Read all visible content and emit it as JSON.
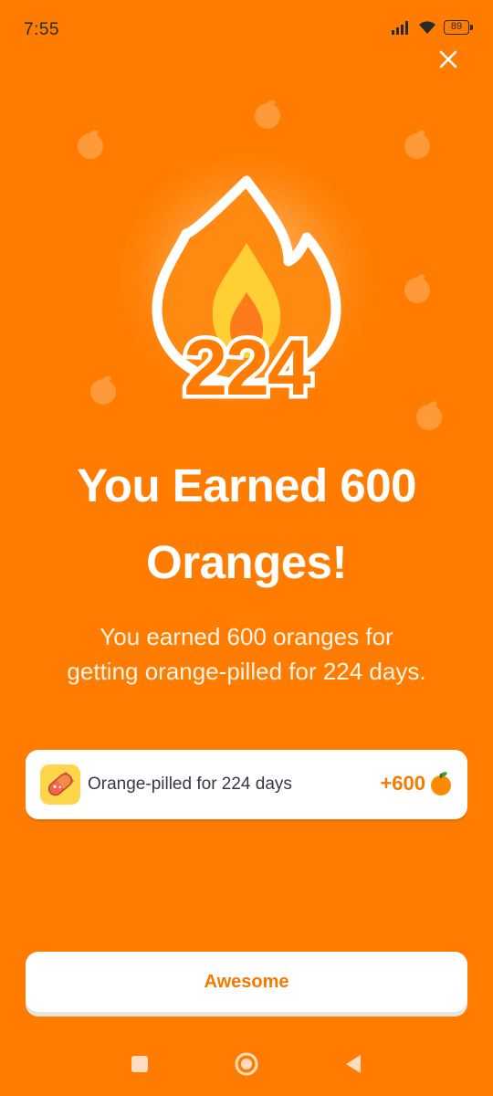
{
  "status_bar": {
    "time": "7:55",
    "battery": "89",
    "icons": [
      "signal-icon",
      "wifi-icon",
      "battery-icon"
    ]
  },
  "hero": {
    "streak_number": "224",
    "icon": "fire-icon"
  },
  "title": "You Earned 600 Oranges!",
  "subtitle": "You earned 600 oranges for getting orange-pilled for 224 days.",
  "reward": {
    "icon": "pill-icon",
    "label": "Orange-pilled for 224 days",
    "value": "+600",
    "value_icon": "orange-icon"
  },
  "cta": {
    "label": "Awesome"
  },
  "nav": {
    "icons": [
      "recent-apps-icon",
      "home-icon",
      "back-icon"
    ]
  },
  "colors": {
    "background": "#FF7C00",
    "accent": "#F47A00",
    "card": "#FFFFFF",
    "pill_box": "#FFD64A"
  }
}
